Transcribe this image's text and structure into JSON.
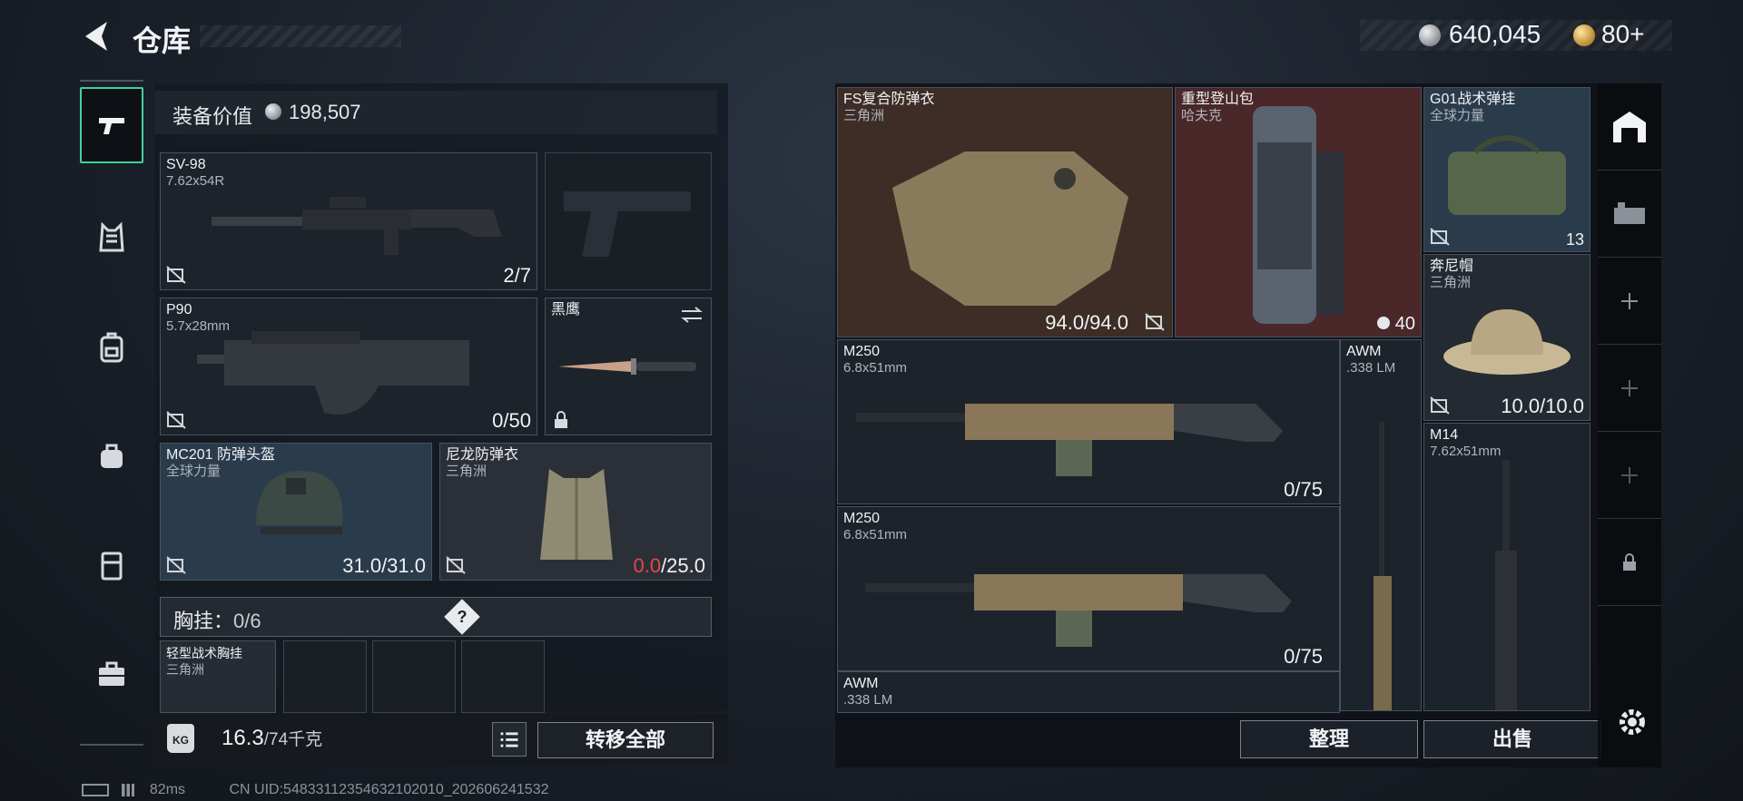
{
  "header": {
    "title": "仓库",
    "currency_silver": "640,045",
    "currency_gold": "80+"
  },
  "rail": {
    "items": [
      "pistol-icon",
      "vest-icon",
      "backpack-icon",
      "bag-icon",
      "case-icon",
      "toolbox-icon"
    ]
  },
  "equipment": {
    "value_label": "装备价值",
    "value": "198,507",
    "slots": [
      {
        "name": "SV-98",
        "sub": "7.62x54R",
        "value": "2/7"
      },
      {
        "name": "",
        "sub": "",
        "value": ""
      },
      {
        "name": "P90",
        "sub": "5.7x28mm",
        "value": "0/50"
      },
      {
        "name": "黑鹰",
        "sub": "",
        "value": ""
      },
      {
        "name": "MC201 防弹头盔",
        "sub": "全球力量",
        "value": "31.0/31.0"
      },
      {
        "name": "尼龙防弹衣",
        "sub": "三角洲",
        "value_red": "0.0",
        "value_rest": "/25.0"
      }
    ],
    "chest_rig_label": "胸挂：",
    "chest_rig_count": "0/6",
    "help": "?",
    "rig_item_name": "轻型战术胸挂",
    "rig_item_sub": "三角洲"
  },
  "bottom_left": {
    "kg_icon": "KG",
    "weight": "16.3",
    "weight_max": "/74千克",
    "transfer_all": "转移全部"
  },
  "storage": {
    "items": [
      {
        "name": "FS复合防弹衣",
        "sub": "三角洲",
        "value": "94.0/94.0"
      },
      {
        "name": "重型登山包",
        "sub": "哈夫克",
        "value": "40"
      },
      {
        "name": "G01战术弹挂",
        "sub": "全球力量",
        "value": "13"
      },
      {
        "name": "奔尼帽",
        "sub": "三角洲",
        "value": "10.0/10.0"
      },
      {
        "name": "M250",
        "sub": "6.8x51mm",
        "value": "0/75"
      },
      {
        "name": "AWM",
        "sub": ".338 LM",
        "value": ""
      },
      {
        "name": "M14",
        "sub": "7.62x51mm",
        "value": ""
      },
      {
        "name": "M250",
        "sub": "6.8x51mm",
        "value": "0/75"
      },
      {
        "name": "AWM",
        "sub": ".338 LM",
        "value": ""
      }
    ],
    "sort_button": "整理",
    "sell_button": "出售"
  },
  "status_bar": {
    "ping": "82ms",
    "uid": "CN UID:54833112354632102010_202606241532"
  }
}
